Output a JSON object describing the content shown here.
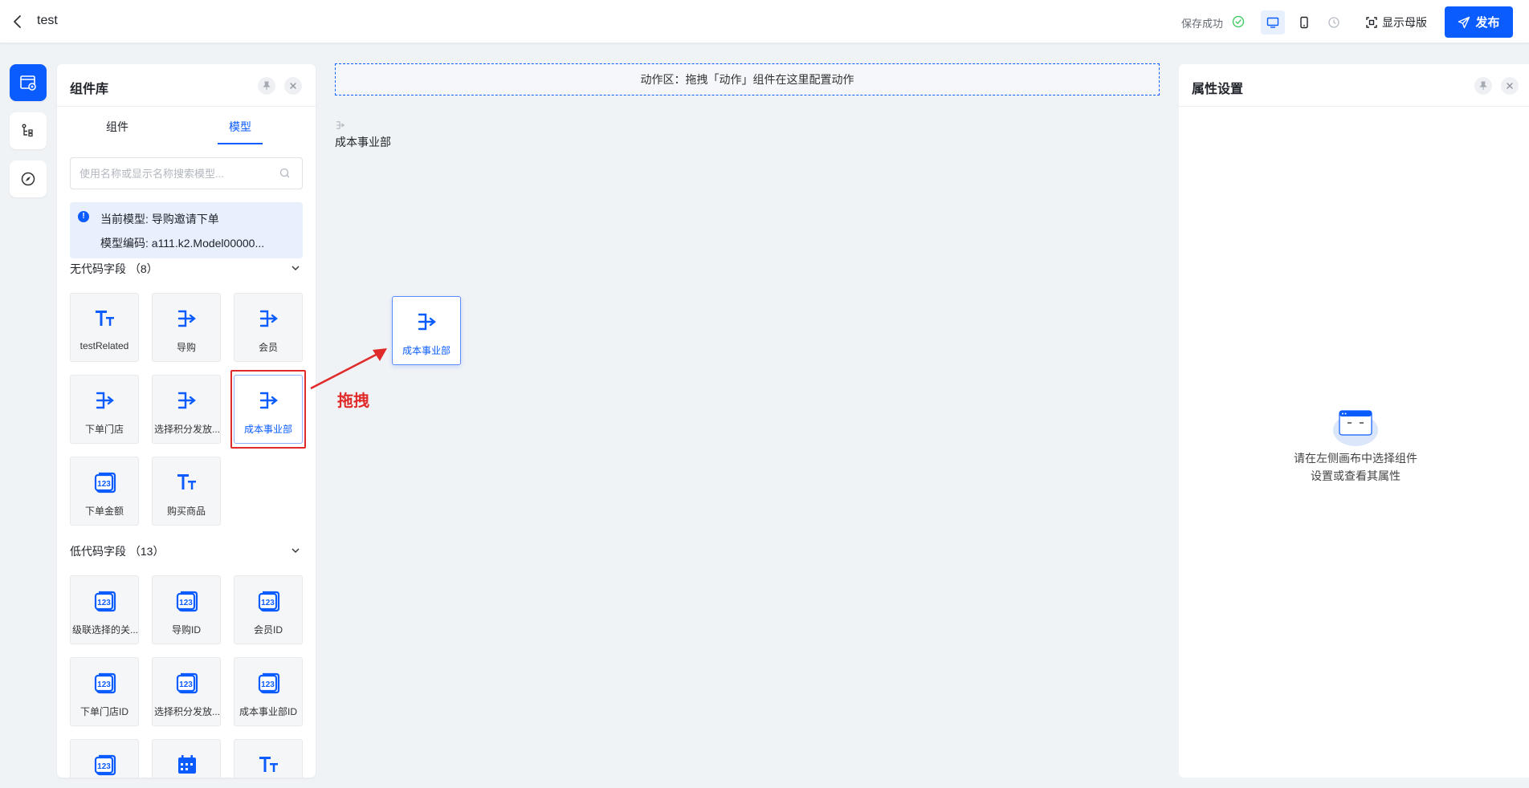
{
  "header": {
    "title": "test",
    "save_status": "保存成功",
    "master_label": "显示母版",
    "publish_label": "发布"
  },
  "rail": {
    "items": [
      "page-icon",
      "tree-icon",
      "compass-icon"
    ]
  },
  "library": {
    "title": "组件库",
    "tabs": [
      "组件",
      "模型"
    ],
    "active_tab": "模型",
    "search_placeholder": "使用名称或显示名称搜索模型...",
    "model_name": "当前模型: 导购邀请下单",
    "model_code": "模型编码: a111.k2.Model00000...",
    "sections": [
      {
        "title": "无代码字段 （8）",
        "items": [
          {
            "label": "testRelated",
            "icon": "text-icon"
          },
          {
            "label": "导购",
            "icon": "relation-icon"
          },
          {
            "label": "会员",
            "icon": "relation-icon"
          },
          {
            "label": "下单门店",
            "icon": "relation-icon"
          },
          {
            "label": "选择积分发放...",
            "icon": "relation-icon"
          },
          {
            "label": "成本事业部",
            "icon": "relation-icon"
          },
          {
            "label": "下单金额",
            "icon": "number-icon"
          },
          {
            "label": "购买商品",
            "icon": "text-icon"
          }
        ]
      },
      {
        "title": "低代码字段 （13）",
        "items": [
          {
            "label": "级联选择的关...",
            "icon": "number-icon"
          },
          {
            "label": "导购ID",
            "icon": "number-icon"
          },
          {
            "label": "会员ID",
            "icon": "number-icon"
          },
          {
            "label": "下单门店ID",
            "icon": "number-icon"
          },
          {
            "label": "选择积分发放...",
            "icon": "number-icon"
          },
          {
            "label": "成本事业部ID",
            "icon": "number-icon"
          },
          {
            "label": "",
            "icon": "number-icon"
          },
          {
            "label": "",
            "icon": "calendar-icon"
          },
          {
            "label": "",
            "icon": "text-icon"
          }
        ]
      }
    ]
  },
  "canvas": {
    "action_zone": "动作区：拖拽「动作」组件在这里配置动作",
    "field_label": "成本事业部",
    "drag_ghost_label": "成本事业部",
    "annotation": "拖拽"
  },
  "properties": {
    "title": "属性设置",
    "empty_line1": "请在左侧画布中选择组件",
    "empty_line2": "设置或查看其属性"
  },
  "colors": {
    "primary": "#0b5cff",
    "annotation": "#e02b2b",
    "success": "#34c759"
  }
}
